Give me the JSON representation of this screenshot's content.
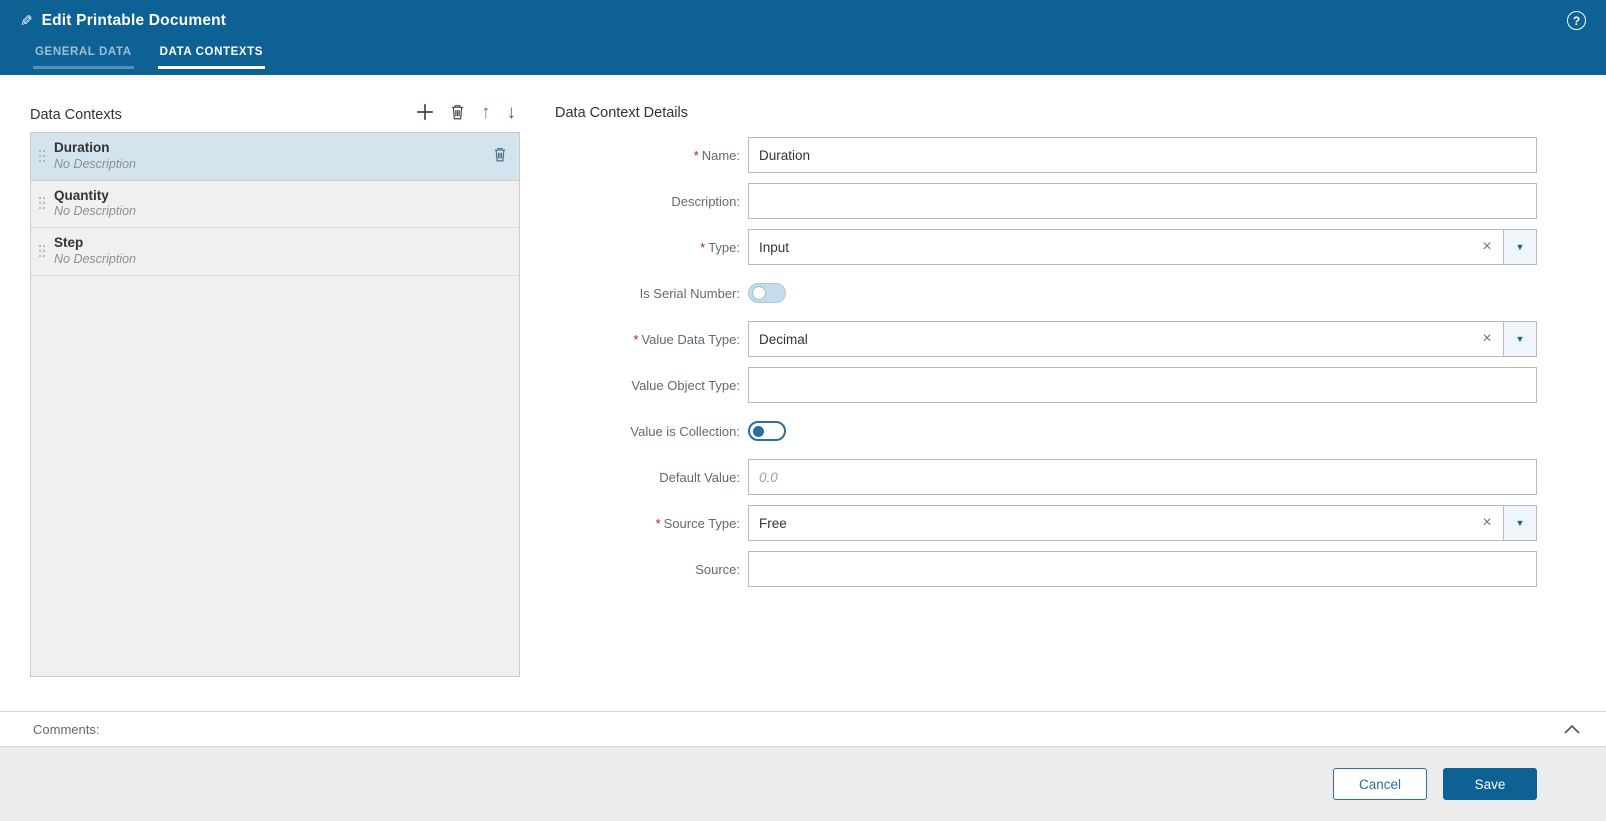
{
  "header": {
    "title": "Edit Printable Document",
    "tabs": [
      {
        "label": "GENERAL DATA"
      },
      {
        "label": "DATA CONTEXTS"
      }
    ]
  },
  "left_panel": {
    "title": "Data Contexts",
    "items": [
      {
        "name": "Duration",
        "description": "No Description",
        "selected": true
      },
      {
        "name": "Quantity",
        "description": "No Description",
        "selected": false
      },
      {
        "name": "Step",
        "description": "No Description",
        "selected": false
      }
    ]
  },
  "details": {
    "title": "Data Context Details",
    "required_marker": "*",
    "fields": {
      "name": {
        "label": "Name:",
        "value": "Duration",
        "required": true
      },
      "description": {
        "label": "Description:",
        "value": "",
        "required": false
      },
      "type": {
        "label": "Type:",
        "value": "Input",
        "required": true
      },
      "is_serial_number": {
        "label": "Is Serial Number:",
        "state": "off"
      },
      "value_data_type": {
        "label": "Value Data Type:",
        "value": "Decimal",
        "required": true
      },
      "value_object_type": {
        "label": "Value Object Type:",
        "value": "",
        "required": false
      },
      "value_is_collection": {
        "label": "Value is Collection:",
        "state": "off"
      },
      "default_value": {
        "label": "Default Value:",
        "value": "",
        "placeholder": "0.0",
        "required": false
      },
      "source_type": {
        "label": "Source Type:",
        "value": "Free",
        "required": true
      },
      "source": {
        "label": "Source:",
        "value": "",
        "required": false
      }
    }
  },
  "comments": {
    "label": "Comments:"
  },
  "footer": {
    "cancel_label": "Cancel",
    "save_label": "Save"
  },
  "icons": {
    "edit": "✎",
    "help": "?",
    "move_up": "↑",
    "move_down": "↓",
    "clear": "×",
    "dropdown": "▼"
  },
  "colors": {
    "header_blue": "#0e6194",
    "accent_blue": "#2a6f9e",
    "selected_item": "#d4e4ef",
    "required_red": "#aa2222"
  }
}
